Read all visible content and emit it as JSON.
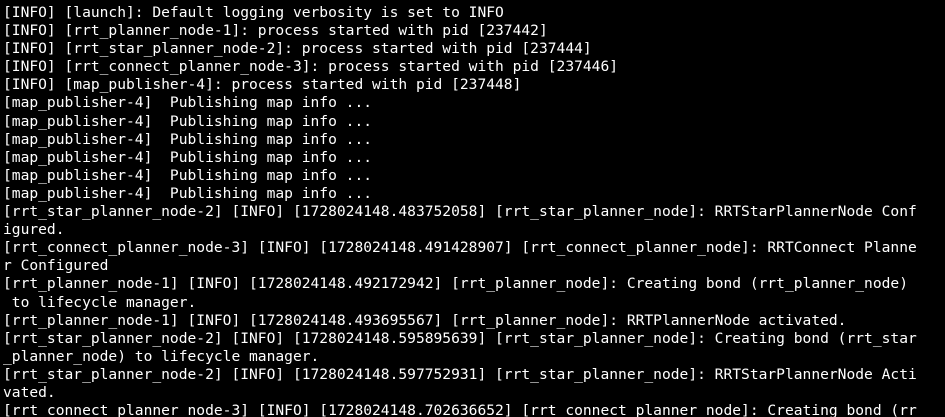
{
  "terminal": {
    "colors": {
      "background": "#000000",
      "foreground": "#ffffff"
    },
    "lines": [
      "[INFO] [launch]: Default logging verbosity is set to INFO",
      "[INFO] [rrt_planner_node-1]: process started with pid [237442]",
      "[INFO] [rrt_star_planner_node-2]: process started with pid [237444]",
      "[INFO] [rrt_connect_planner_node-3]: process started with pid [237446]",
      "[INFO] [map_publisher-4]: process started with pid [237448]",
      "[map_publisher-4]  Publishing map info ...",
      "[map_publisher-4]  Publishing map info ...",
      "[map_publisher-4]  Publishing map info ...",
      "[map_publisher-4]  Publishing map info ...",
      "[map_publisher-4]  Publishing map info ...",
      "[map_publisher-4]  Publishing map info ...",
      "[rrt_star_planner_node-2] [INFO] [1728024148.483752058] [rrt_star_planner_node]: RRTStarPlannerNode Conf",
      "igured.",
      "[rrt_connect_planner_node-3] [INFO] [1728024148.491428907] [rrt_connect_planner_node]: RRTConnect Planne",
      "r Configured",
      "[rrt_planner_node-1] [INFO] [1728024148.492172942] [rrt_planner_node]: Creating bond (rrt_planner_node)",
      " to lifecycle manager.",
      "[rrt_planner_node-1] [INFO] [1728024148.493695567] [rrt_planner_node]: RRTPlannerNode activated.",
      "[rrt_star_planner_node-2] [INFO] [1728024148.595895639] [rrt_star_planner_node]: Creating bond (rrt_star",
      "_planner_node) to lifecycle manager.",
      "[rrt_star_planner_node-2] [INFO] [1728024148.597752931] [rrt_star_planner_node]: RRTStarPlannerNode Acti",
      "vated.",
      "[rrt_connect_planner_node-3] [INFO] [1728024148.702636652] [rrt_connect_planner_node]: Creating bond (rr"
    ]
  }
}
